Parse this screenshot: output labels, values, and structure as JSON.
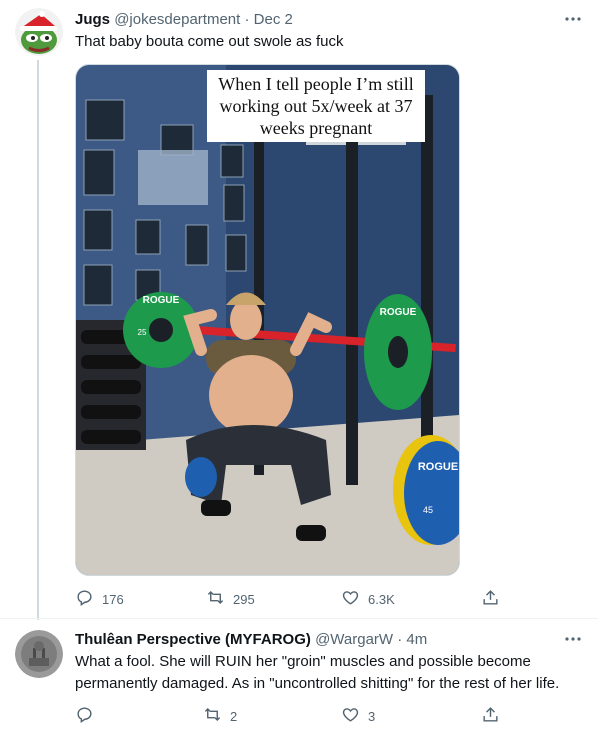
{
  "tweet1": {
    "name": "Jugs",
    "handle": "@jokesdepartment",
    "dot": "·",
    "time": "Dec 2",
    "text": "That baby bouta come out swole as fuck",
    "media_caption": "When I tell people I’m still working out 5x/week at 37 weeks pregnant",
    "plate_brand": "ROGUE",
    "plate_weight_small": "25",
    "plate_weight_large": "45",
    "replies": "176",
    "retweets": "295",
    "likes": "6.3K"
  },
  "tweet2": {
    "name": "Thulêan Perspective (MYFAROG)",
    "handle": "@WargarW",
    "dot": "·",
    "time": "4m",
    "text_line1": "What a fool. She will RUIN her \"groin\" muscles and possible become",
    "text_line2": "permanently damaged. As in \"uncontrolled shitting\" for the rest of her life.",
    "retweets": "2",
    "likes": "3"
  },
  "icons": {
    "reply": "reply-icon",
    "retweet": "retweet-icon",
    "like": "heart-icon",
    "share": "share-icon",
    "more": "more-icon"
  },
  "colors": {
    "text": "#0f1419",
    "secondary": "#536471",
    "plate_green": "#1d9a4c",
    "bar_red": "#d8232a",
    "wall_blue": "#3d5a86"
  }
}
